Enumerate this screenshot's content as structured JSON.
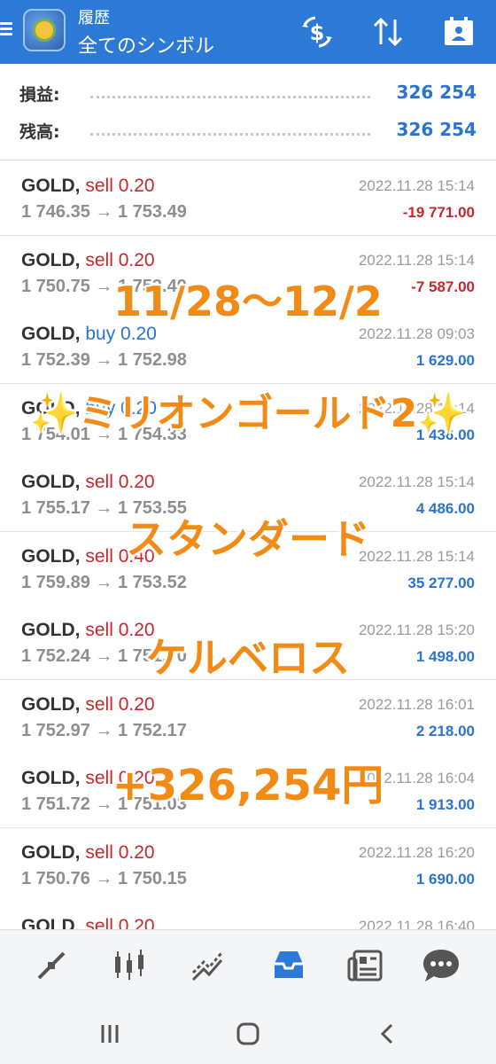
{
  "header": {
    "title": "履歴",
    "subtitle": "全てのシンボル",
    "accent": "#2c7ad6",
    "icons": [
      "menu-icon",
      "metatrader-logo",
      "deposit-withdraw-icon",
      "sort-icon",
      "calendar-icon"
    ]
  },
  "summary": {
    "profit_label": "損益:",
    "profit_value": "326 254",
    "balance_label": "残高:",
    "balance_value": "326 254"
  },
  "trades": [
    {
      "symbol": "GOLD,",
      "side": "sell",
      "side_text": "sell 0.20",
      "prices": "1 746.35 → 1 753.49",
      "time": "2022.11.28 15:14",
      "profit": "-19 771.00",
      "sign": "neg"
    },
    {
      "symbol": "GOLD,",
      "side": "sell",
      "side_text": "sell 0.20",
      "prices": "1 750.75 → 1 753.49",
      "time": "2022.11.28 15:14",
      "profit": "-7 587.00",
      "sign": "neg"
    },
    {
      "symbol": "GOLD,",
      "side": "buy",
      "side_text": "buy 0.20",
      "prices": "1 752.39 → 1 752.98",
      "time": "2022.11.28 09:03",
      "profit": "1 629.00",
      "sign": "pos"
    },
    {
      "symbol": "GOLD,",
      "side": "buy",
      "side_text": "buy 0.20",
      "prices": "1 754.01 → 1 754.33",
      "time": "2022.11.28 15:14",
      "profit": "1 436.00",
      "sign": "pos"
    },
    {
      "symbol": "GOLD,",
      "side": "sell",
      "side_text": "sell 0.20",
      "prices": "1 755.17 → 1 753.55",
      "time": "2022.11.28 15:14",
      "profit": "4 486.00",
      "sign": "pos"
    },
    {
      "symbol": "GOLD,",
      "side": "sell",
      "side_text": "sell 0.40",
      "prices": "1 759.89 → 1 753.52",
      "time": "2022.11.28 15:14",
      "profit": "35 277.00",
      "sign": "pos"
    },
    {
      "symbol": "GOLD,",
      "side": "sell",
      "side_text": "sell 0.20",
      "prices": "1 752.24 → 1 751.70",
      "time": "2022.11.28 15:20",
      "profit": "1 498.00",
      "sign": "pos"
    },
    {
      "symbol": "GOLD,",
      "side": "sell",
      "side_text": "sell 0.20",
      "prices": "1 752.97 → 1 752.17",
      "time": "2022.11.28 16:01",
      "profit": "2 218.00",
      "sign": "pos"
    },
    {
      "symbol": "GOLD,",
      "side": "sell",
      "side_text": "sell 0.20",
      "prices": "1 751.72 → 1 751.03",
      "time": "2022.11.28 16:04",
      "profit": "1 913.00",
      "sign": "pos"
    },
    {
      "symbol": "GOLD,",
      "side": "sell",
      "side_text": "sell 0.20",
      "prices": "1 750.76 → 1 750.15",
      "time": "2022.11.28 16:20",
      "profit": "1 690.00",
      "sign": "pos"
    },
    {
      "symbol": "GOLD,",
      "side": "sell",
      "side_text": "sell 0.20",
      "prices": "",
      "time": "2022.11.28 16:40",
      "profit": "",
      "sign": "pos"
    }
  ],
  "overlay": {
    "line1": "11/28〜12/2",
    "line2_sparkle_left": "✨",
    "line2": "ミリオンゴールド2",
    "line2_sparkle_right": "✨",
    "line3": "スタンダード",
    "line4": "ケルベロス",
    "line5": "+326,254円",
    "color": "#f28b16"
  },
  "bottom_nav": {
    "items": [
      "quotes-icon",
      "chart-icon",
      "trade-icon",
      "history-icon",
      "news-icon",
      "chat-icon"
    ],
    "active": "history-icon",
    "active_color": "#2c7ad6"
  },
  "system_nav": [
    "recent-apps-icon",
    "home-icon",
    "back-icon"
  ]
}
